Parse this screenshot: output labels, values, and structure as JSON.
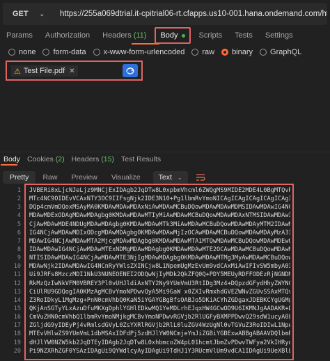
{
  "request": {
    "method": "GET",
    "url": "https://255a069dtrial.it-cpitrial06-rt.cfapps.us10-001.hana.ondemand.com/http/encodeToBase64"
  },
  "request_tabs": [
    {
      "label": "Params",
      "count": ""
    },
    {
      "label": "Authorization",
      "count": ""
    },
    {
      "label": "Headers",
      "count": "(11)"
    },
    {
      "label": "Body",
      "count": ""
    },
    {
      "label": "Scripts",
      "count": ""
    },
    {
      "label": "Tests",
      "count": ""
    },
    {
      "label": "Settings",
      "count": ""
    }
  ],
  "body_types": [
    {
      "label": "none"
    },
    {
      "label": "form-data"
    },
    {
      "label": "x-www-form-urlencoded"
    },
    {
      "label": "raw"
    },
    {
      "label": "binary"
    },
    {
      "label": "GraphQL"
    }
  ],
  "file": {
    "name": "Test File.pdf"
  },
  "response_tabs": [
    {
      "label": "Body",
      "count": ""
    },
    {
      "label": "Cookies",
      "count": "(2)"
    },
    {
      "label": "Headers",
      "count": "(15)"
    },
    {
      "label": "Test Results",
      "count": ""
    }
  ],
  "view_modes": [
    {
      "label": "Pretty"
    },
    {
      "label": "Raw"
    },
    {
      "label": "Preview"
    },
    {
      "label": "Visualize"
    }
  ],
  "format_select": "Text",
  "colors": {
    "accent": "#ff6c37",
    "highlight": "#e06464",
    "upload_button": "#2f6fdb"
  },
  "code_lines": [
    {
      "no": "1",
      "text": "JVBERi0xLjcNJeLjz9MNCjExIDAgb2JqDTw8L0xpbmVhcml6ZWQgMS9MIDE2MDE4L0BgMTQvRSAx"
    },
    {
      "no": "2",
      "text": "MTc4NC9OIDEvVCAxNTY3OC9IIFsgNjk2IDE3N10+Pg1lbmRvYmoNICAgICAgICAgICAgICAgICAg"
    },
    {
      "no": "3",
      "text": "DQp4cmVmDQoxMSAyMA0KMDAwMDAwMDAxNiAwMDAwMCBuDQowMDAwMDAwMDMSIDAwMDAwIG4NCjAw"
    },
    {
      "no": "4",
      "text": "MDAwMDExODAgMDAwMDAgbg0KMDAwMDAwMTIyMiAwMDAwMCBuDQowMDAwMDAxNTMSIDAwMDAwIG4N"
    },
    {
      "no": "5",
      "text": "CjAwMDAwMDE4NDUgMDAwMDAgbg0KMDAwMDAwMTk3MiAwMDAwMCBuDQowMDAwMDAyMTM2IDAwMDAw"
    },
    {
      "no": "6",
      "text": "IG4NCjAwMDAwMDIxODcgMDAwMDAgbg0KMDAwMDAwMjIzOCAwMDAwMCBuDQowMDAwMDAyMzA3IDAw"
    },
    {
      "no": "7",
      "text": "MDAwIG4NCjAwMDAwMTA2MjcgMDAwMDAgbg0KMDAwMDAwMTA1MTQwMDAwMCBuDQowMDAwMDEwOTg4"
    },
    {
      "no": "8",
      "text": "IDAwMDAwIG4NCjAwMDAwMTExNDMgMDAwMDAgbg0KMDAwMDAwMTE2OCAwMDAwMCBuDQowMDAwMDEx"
    },
    {
      "no": "9",
      "text": "NTISIDAwMDAwIG4NCjAwMDAwMTE3NjIgMDAwMDAgbg0KMDAwMDAwMTMg3MyAwMDAwMCBuDQowMDAw"
    },
    {
      "no": "10",
      "text": "MDAwNjk2IDAwMDAwIG4NCnRyYWlsZXINCjw8L1NpemUgMzEvUm9vdCAxMiAwIFIvSW5mbyA0IDAg"
    },
    {
      "no": "11",
      "text": "Ui9JRFs8MzczMDI1NkU3NUNEOENEI2ODQwNjIyMDk2QkZFQ0Q+PDY5MEUyRDFFODEzRjNGNDM4"
    },
    {
      "no": "12",
      "text": "RkMzQzIwNkVFM0VBREY3Pl0vUHJldiAxNTY2Ny9YUmVmU3RtIDg3Mz4+DQpzdGFydHhyZWYNCjAN"
    },
    {
      "no": "13",
      "text": "CiUlRU9GDQogIA0KMzAgMCBvYmoNPDwvQyA5Mi9GaW x0ZXIvRmxhdGVEZWNvZGUvSSAxMTQvTGVu"
    },
    {
      "no": "14",
      "text": "Z3RoIDkyL1MgMzg+PnN0cmVhbQ0KaN5iYGAYGBgBfsOABJo5DKiACYhZGDgaxJDEBKCYgUGMgY8h"
    },
    {
      "no": "15",
      "text": "QKjAnSGTyYLxAzuDfuMKXgDphlYGHlEDkwMQ1YeMDLrhEJqxHW4GCwOD9U6IKMNJgAADAKR+DBkN"
    },
    {
      "no": "16",
      "text": "CmVuZHN0cmVhbQ1lbmRvYmoNMjkgMCBvYmoNPDwvRGVjb2RlUGFyBXMPPDwvQ29sdW1ucyA0L1By"
    },
    {
      "no": "17",
      "text": "ZGljdG9yIDEyPj4vRmlsdGVyL0ZsYXRlRGVjb2RlL0luZGV4WzUgNl0vTGVuZ3RoIDIwL1NpemUg"
    },
    {
      "no": "18",
      "text": "MTEvVHlwZS9YUmVmL1dbMSAxIDFdPj5zdHJlYW0NCmjeYmJiZGBiYGBExwABBgABAAVDQlbmRz"
    },
    {
      "no": "19",
      "text": "dHJlYW0NZW5kb2JqDTEyIDAgb2JqDTw8L0xhbmcoZW4pL01hcmtJbmZvPDwvTWFya2VkIHRydWU+"
    },
    {
      "no": "20",
      "text": "Pi9NZXRhZGF0YSAzIDAgUi9QYWdlcyAyIDAgUi9TdHJ1Y3RUcmVlUm9vdCA1IDAgUi9UeXBlL0Nh"
    }
  ]
}
